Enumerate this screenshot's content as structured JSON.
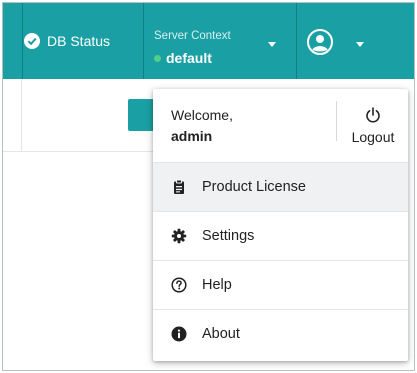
{
  "topbar": {
    "db_status_label": "DB Status",
    "server_context_title": "Server Context",
    "server_context_value": "default"
  },
  "dropdown": {
    "welcome": "Welcome,",
    "username": "admin",
    "logout": "Logout",
    "items": [
      {
        "label": "Product License",
        "icon": "clipboard-icon"
      },
      {
        "label": "Settings",
        "icon": "gear-icon"
      },
      {
        "label": "Help",
        "icon": "question-circle-icon"
      },
      {
        "label": "About",
        "icon": "info-circle-icon"
      }
    ]
  },
  "colors": {
    "topbar": "#1aa0a4",
    "status_dot": "#4ed08a",
    "hover_row": "#f0f1f2"
  }
}
